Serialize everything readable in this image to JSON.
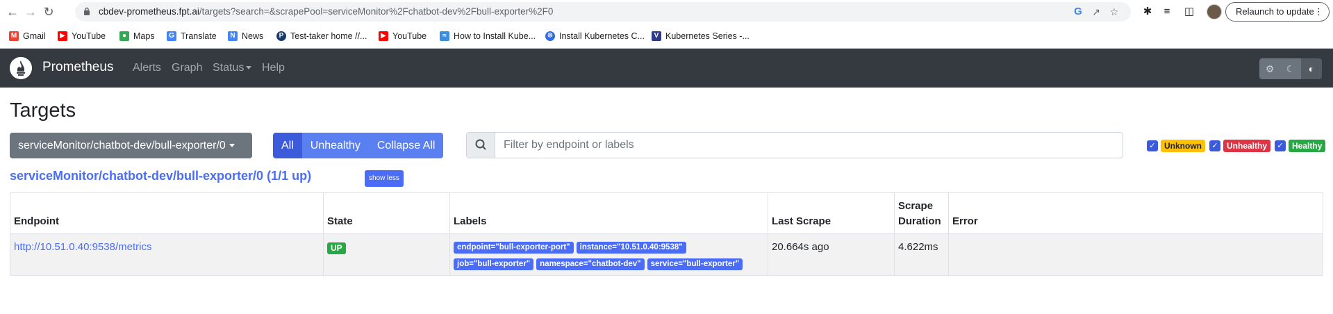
{
  "browser": {
    "url_host": "cbdev-prometheus.fpt.ai",
    "url_path": "/targets?search=&scrapePool=serviceMonitor%2Fchatbot-dev%2Fbull-exporter%2F0",
    "relaunch_label": "Relaunch to update",
    "bookmarks": [
      {
        "label": "Gmail",
        "icon": "gmail-icon",
        "color": "#ea4335"
      },
      {
        "label": "YouTube",
        "icon": "youtube-icon",
        "color": "#ff0000"
      },
      {
        "label": "Maps",
        "icon": "maps-icon",
        "color": "#34a853"
      },
      {
        "label": "Translate",
        "icon": "translate-icon",
        "color": "#4285f4"
      },
      {
        "label": "News",
        "icon": "news-icon",
        "color": "#4285f4"
      },
      {
        "label": "Test-taker home //...",
        "icon": "test-taker-icon",
        "color": "#1a3a6b"
      },
      {
        "label": "YouTube",
        "icon": "youtube-icon",
        "color": "#ff0000"
      },
      {
        "label": "How to Install Kube...",
        "icon": "kube-icon",
        "color": "#3a8de0"
      },
      {
        "label": "Install Kubernetes C...",
        "icon": "kubernetes-icon",
        "color": "#326ce5"
      },
      {
        "label": "Kubernetes Series -...",
        "icon": "vcode-icon",
        "color": "#2b3a8c"
      }
    ]
  },
  "navbar": {
    "brand": "Prometheus",
    "links": [
      "Alerts",
      "Graph",
      "Status",
      "Help"
    ]
  },
  "page": {
    "title": "Targets",
    "pool_select": "serviceMonitor/chatbot-dev/bull-exporter/0",
    "filter_buttons": [
      "All",
      "Unhealthy",
      "Collapse All"
    ],
    "search_placeholder": "Filter by endpoint or labels",
    "health_filters": [
      "Unknown",
      "Unhealthy",
      "Healthy"
    ],
    "pool_heading": "serviceMonitor/chatbot-dev/bull-exporter/0 (1/1 up)",
    "show_less": "show less"
  },
  "table": {
    "headers": [
      "Endpoint",
      "State",
      "Labels",
      "Last Scrape",
      "Scrape Duration",
      "Error"
    ],
    "rows": [
      {
        "endpoint": "http://10.51.0.40:9538/metrics",
        "state": "UP",
        "labels": [
          "endpoint=\"bull-exporter-port\"",
          "instance=\"10.51.0.40:9538\"",
          "job=\"bull-exporter\"",
          "namespace=\"chatbot-dev\"",
          "service=\"bull-exporter\""
        ],
        "last_scrape": "20.664s ago",
        "scrape_duration": "4.622ms",
        "error": ""
      }
    ]
  },
  "colors": {
    "navbar_bg": "#343a40",
    "primary": "#4a6cf7",
    "secondary": "#6c757d",
    "success": "#28a745",
    "danger": "#dc3545",
    "warning": "#ffc107"
  }
}
